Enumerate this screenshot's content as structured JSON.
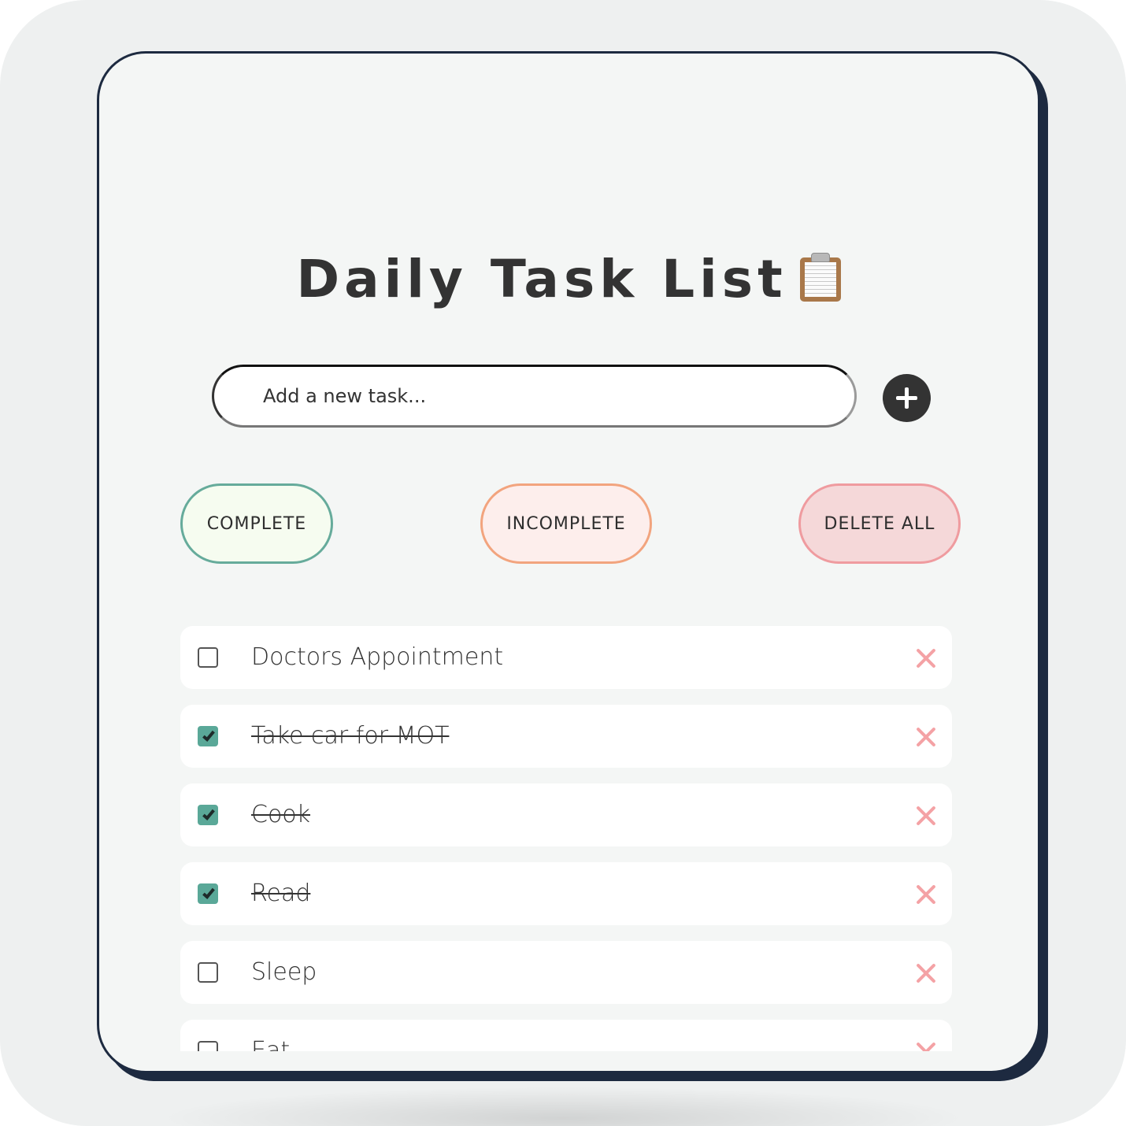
{
  "app": {
    "title": "Daily Task List",
    "title_icon": "clipboard-icon"
  },
  "input": {
    "placeholder": "Add a new task...",
    "value": "",
    "add_icon": "plus-icon"
  },
  "filters": {
    "complete_label": "COMPLETE",
    "incomplete_label": "INCOMPLETE",
    "delete_all_label": "DELETE ALL"
  },
  "tasks": [
    {
      "text": "Doctors Appointment",
      "done": false
    },
    {
      "text": "Take car for MOT",
      "done": true
    },
    {
      "text": "Cook",
      "done": true
    },
    {
      "text": "Read",
      "done": true
    },
    {
      "text": "Sleep",
      "done": false
    },
    {
      "text": "Eat",
      "done": false
    }
  ],
  "colors": {
    "frame": "#1d2a40",
    "complete_border": "#66ab9b",
    "incomplete_border": "#f2a47e",
    "delete_border": "#ef9b9f",
    "checked_fill": "#5aa898",
    "delete_icon": "#f4a2a5"
  }
}
